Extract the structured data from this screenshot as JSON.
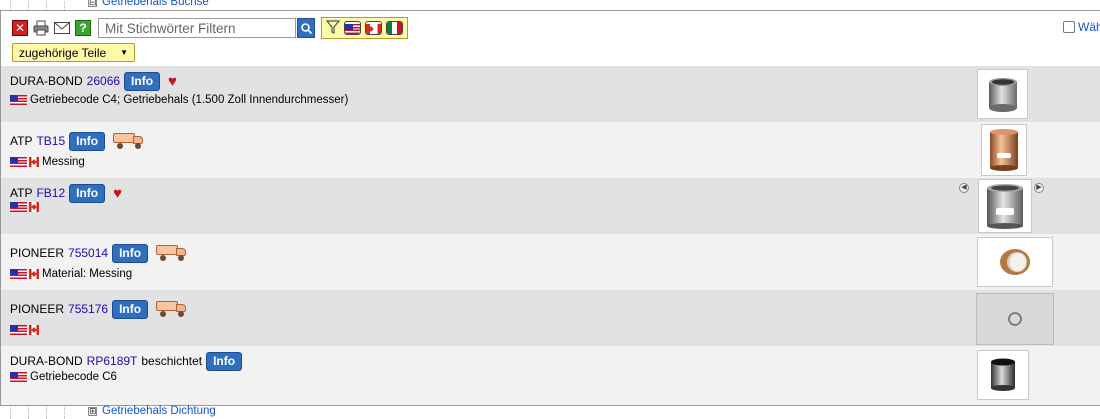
{
  "tree": {
    "top_label": "Getriebehals Buchse",
    "top_toggle": "⊟",
    "bottom_label": "Getriebehals Dichtung",
    "bottom_toggle": "⊞"
  },
  "toolbar": {
    "search_placeholder": "Mit Stichwörter Filtern",
    "close_glyph": "✕",
    "help_glyph": "?",
    "dropdown_label": "zugehörige Teile",
    "dropdown_caret": "▼",
    "right_checkbox_label": "Wäh"
  },
  "icons": {
    "close": "close-icon",
    "print": "print-icon",
    "mail": "mail-icon",
    "help": "help-icon",
    "search": "search-icon",
    "filter": "filter-icon",
    "heart": "heart-icon",
    "truck": "truck-icon"
  },
  "colors": {
    "accent_blue": "#2f6fbd",
    "link_blue": "#1a0dab",
    "filter_yellow": "#fff8a8",
    "row_dark": "#e2e2e2",
    "row_light": "#f2f2f2"
  },
  "parts": [
    {
      "brand": "DURA-BOND",
      "part_number": "26066",
      "suffix": "",
      "info_label": "Info",
      "badge": "heart",
      "flags": [
        "us"
      ],
      "description": "Getriebecode C4; Getriebehals (1.500 Zoll Innendurchmesser)"
    },
    {
      "brand": "ATP",
      "part_number": "TB15",
      "suffix": "",
      "info_label": "Info",
      "badge": "truck",
      "flags": [
        "us",
        "ca"
      ],
      "description": "Messing"
    },
    {
      "brand": "ATP",
      "part_number": "FB12",
      "suffix": "",
      "info_label": "Info",
      "badge": "heart",
      "flags": [
        "us",
        "ca"
      ],
      "description": ""
    },
    {
      "brand": "PIONEER",
      "part_number": "755014",
      "suffix": "",
      "info_label": "Info",
      "badge": "truck",
      "flags": [
        "us",
        "ca"
      ],
      "description": "Material: Messing"
    },
    {
      "brand": "PIONEER",
      "part_number": "755176",
      "suffix": "",
      "info_label": "Info",
      "badge": "truck",
      "flags": [
        "us",
        "ca"
      ],
      "description": ""
    },
    {
      "brand": "DURA-BOND",
      "part_number": "RP6189T",
      "suffix": "beschichtet",
      "info_label": "Info",
      "badge": "",
      "flags": [
        "us"
      ],
      "description": "Getriebecode C6"
    }
  ]
}
